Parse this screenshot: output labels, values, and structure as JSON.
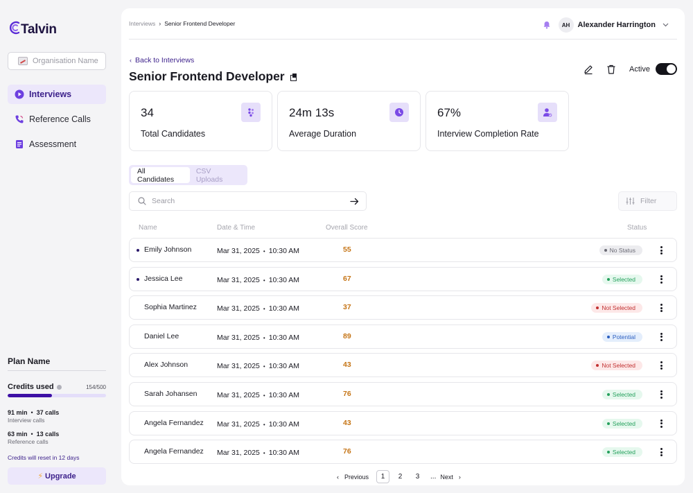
{
  "app": {
    "logo_text": "Talvin",
    "org_name": "Organisation Name"
  },
  "sidebar": {
    "items": [
      {
        "label": "Interviews",
        "icon": "play-icon",
        "active": true
      },
      {
        "label": "Reference Calls",
        "icon": "phone-icon",
        "active": false
      },
      {
        "label": "Assessment",
        "icon": "document-icon",
        "active": false
      }
    ],
    "plan": {
      "title": "Plan Name",
      "credits_label": "Credits used",
      "credits_count": "154/500",
      "credits_used_fraction": 0.45,
      "interview_minutes": "91 min",
      "interview_calls": "37 calls",
      "interview_label": "Interview calls",
      "reference_minutes": "63 min",
      "reference_calls": "13 calls",
      "reference_label": "Reference calls",
      "reset_note": "Credits will reset in 12 days",
      "upgrade_label": "Upgrade"
    }
  },
  "header": {
    "breadcrumb_root": "Interviews",
    "breadcrumb_current": "Senior Frontend Developer",
    "user_initials": "AH",
    "user_name": "Alexander Harrington"
  },
  "page": {
    "back_label": "Back to Interviews",
    "title": "Senior Frontend Developer",
    "active_label": "Active"
  },
  "stats": [
    {
      "value": "34",
      "label": "Total Candidates",
      "icon": "people-icon"
    },
    {
      "value": "24m 13s",
      "label": "Average Duration",
      "icon": "clock-icon"
    },
    {
      "value": "67%",
      "label": "Interview Completion Rate",
      "icon": "user-check-icon"
    }
  ],
  "tabs": [
    {
      "label": "All Candidates",
      "active": true
    },
    {
      "label": "CSV Uploads",
      "active": false
    }
  ],
  "search": {
    "placeholder": "Search"
  },
  "filter": {
    "label": "Filter"
  },
  "table": {
    "columns": [
      "Name",
      "Date & Time",
      "Overall Score",
      "Status"
    ],
    "rows": [
      {
        "name": "Emily Johnson",
        "date": "Mar 31, 2025",
        "time": "10:30 AM",
        "score": "55",
        "status": "No Status",
        "kind": "none",
        "unread": true
      },
      {
        "name": "Jessica Lee",
        "date": "Mar 31, 2025",
        "time": "10:30 AM",
        "score": "67",
        "status": "Selected",
        "kind": "selected",
        "unread": true
      },
      {
        "name": "Sophia Martinez",
        "date": "Mar 31, 2025",
        "time": "10:30 AM",
        "score": "37",
        "status": "Not Selected",
        "kind": "notsel",
        "unread": false
      },
      {
        "name": "Daniel Lee",
        "date": "Mar 31, 2025",
        "time": "10:30 AM",
        "score": "89",
        "status": "Potential",
        "kind": "potential",
        "unread": false
      },
      {
        "name": "Alex Johnson",
        "date": "Mar 31, 2025",
        "time": "10:30 AM",
        "score": "43",
        "status": "Not Selected",
        "kind": "notsel",
        "unread": false
      },
      {
        "name": "Sarah Johansen",
        "date": "Mar 31, 2025",
        "time": "10:30 AM",
        "score": "76",
        "status": "Selected",
        "kind": "selected",
        "unread": false
      },
      {
        "name": "Angela Fernandez",
        "date": "Mar 31, 2025",
        "time": "10:30 AM",
        "score": "43",
        "status": "Selected",
        "kind": "selected",
        "unread": false
      },
      {
        "name": "Angela Fernandez",
        "date": "Mar 31, 2025",
        "time": "10:30 AM",
        "score": "76",
        "status": "Selected",
        "kind": "selected",
        "unread": false
      }
    ]
  },
  "pagination": {
    "prev_label": "Previous",
    "next_label": "Next",
    "pages": [
      "1",
      "2",
      "3"
    ],
    "current": "1",
    "ellipsis": "..."
  },
  "colors": {
    "brand": "#3d10a5",
    "accent_light": "#ece7fb",
    "score": "#c57415"
  }
}
